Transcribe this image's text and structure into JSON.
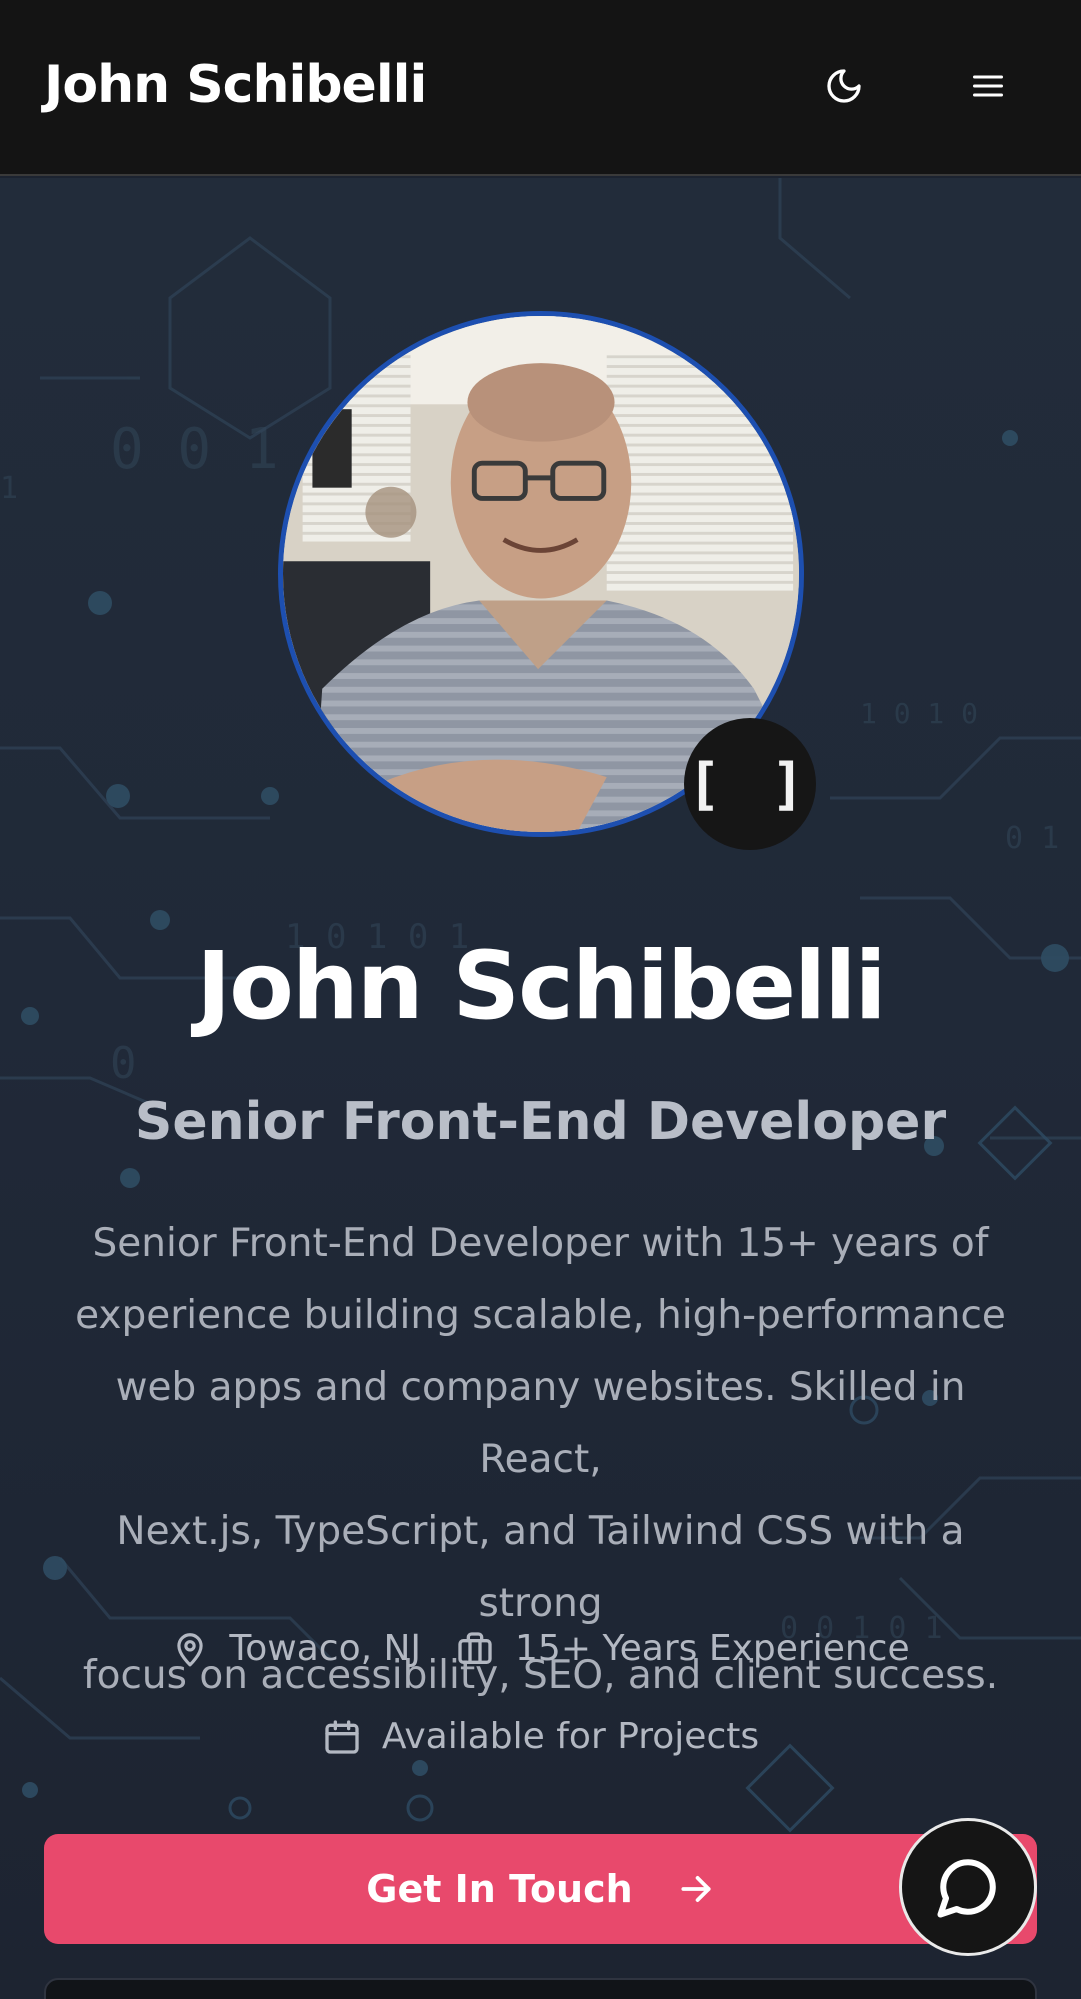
{
  "header": {
    "brand": "John Schibelli",
    "theme_toggle_icon": "moon-icon",
    "menu_icon": "hamburger-menu-icon"
  },
  "hero": {
    "avatar_alt": "John Schibelli",
    "badge_glyph": "[ ]",
    "name": "John Schibelli",
    "role": "Senior Front-End Developer",
    "bio_lines": [
      "Senior Front-End Developer with 15+ years of",
      "experience building scalable, high-performance",
      "web apps and company websites. Skilled in React,",
      "Next.js, TypeScript, and Tailwind CSS with a strong",
      "focus on accessibility, SEO, and client success."
    ],
    "meta": {
      "location": "Towaco, NJ",
      "experience": "15+ Years Experience",
      "availability": "Available for Projects"
    },
    "cta_label": "Get In Touch"
  },
  "colors": {
    "accent": "#e8496c",
    "avatar_ring": "#1d4fb0",
    "header_bg": "#141414",
    "hero_bg": "#202938"
  },
  "icons": {
    "location": "map-pin-icon",
    "experience": "briefcase-icon",
    "availability": "calendar-icon",
    "cta_arrow": "arrow-right-icon",
    "chat": "chat-bubble-icon"
  }
}
